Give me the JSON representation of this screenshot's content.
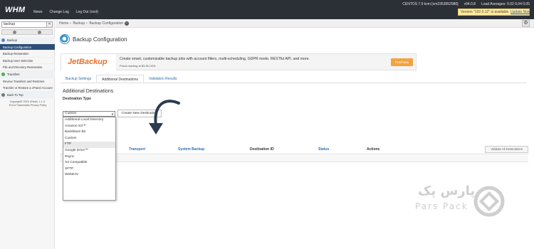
{
  "topbar": {
    "logo": "WHM",
    "nav": [
      "News",
      "Change Log",
      "Log Out (root)"
    ],
    "os": "CENTOS 7.9 kvm [vm2353952980]",
    "version": "v94.0.8",
    "load": "Load Averages: 0.02 0.04 0.05",
    "update_notice": "Version \"102.0.12\" is available.",
    "update_link": "Update Now"
  },
  "sidebar": {
    "search_value": "backup",
    "search_clear": "✕",
    "items": [
      {
        "label": "Backup",
        "type": "category",
        "color": "#5b86c5"
      },
      {
        "label": "Backup Configuration",
        "type": "active"
      },
      {
        "label": "Backup Restoration",
        "type": "item"
      },
      {
        "label": "Backup User Selection",
        "type": "item"
      },
      {
        "label": "File and Directory Restoration",
        "type": "item"
      },
      {
        "label": "Transfers",
        "type": "category",
        "color": "#4caf50"
      },
      {
        "label": "Review Transfers and Restores",
        "type": "item"
      },
      {
        "label": "Transfer or Restore a cPanel Account",
        "type": "item"
      },
      {
        "label": "Back To Top",
        "type": "category",
        "color": "#777777"
      }
    ],
    "footer_copyright": "Copyright© 2022 cPanel, L.L.C.",
    "footer_links": "EULA  Trademarks  Privacy Policy"
  },
  "breadcrumb": {
    "home": "Home",
    "section": "Backup",
    "page": "Backup Configuration",
    "help": "?"
  },
  "page": {
    "title": "Backup Configuration"
  },
  "banner": {
    "brand": "JetBackup",
    "text": "Create smart, customizable backup jobs with account filters, multi-scheduling, GDPR mode, RESTful API, and more.",
    "price": "Prices starting at $3.95 USD",
    "purchase": "Purchase"
  },
  "tabs": [
    "Backup Settings",
    "Additional Destinations",
    "Validation Results"
  ],
  "section": {
    "title": "Additional Destinations",
    "dest_type_label": "Destination Type",
    "select_value": "Custom",
    "create_button": "Create New Destination",
    "options": [
      "Additional Local Directory",
      "Amazon S3™",
      "Backblaze B2",
      "Custom",
      "FTP",
      "Google Drive™",
      "Rsync",
      "S3 Compatible",
      "SFTP",
      "WebDAV"
    ],
    "highlighted_option": "FTP"
  },
  "table": {
    "headers": [
      "Transport",
      "System Backup",
      "Destination ID",
      "Status",
      "Actions"
    ],
    "validate_button": "Validate All Destinations"
  },
  "watermark": {
    "fa": "پارس پک",
    "en": "Pars Pack"
  },
  "colors": {
    "topbar": "#2b2f36",
    "sidebar_active": "#2b4e79",
    "link": "#2f6db0",
    "jetbackup": "#e8702a",
    "purchase": "#f3a33e"
  }
}
